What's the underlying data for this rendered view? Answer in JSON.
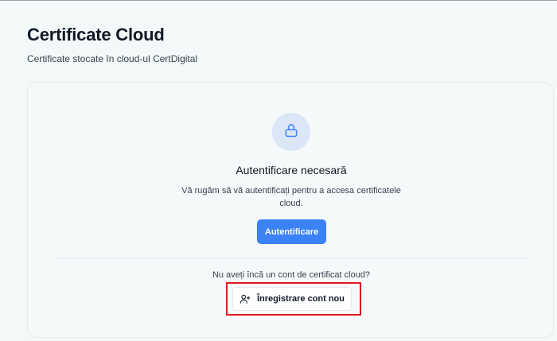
{
  "header": {
    "title": "Certificate Cloud",
    "subtitle": "Certificate stocate în cloud-ul CertDigital"
  },
  "auth_card": {
    "lock_icon": "lock-icon",
    "title": "Autentificare necesară",
    "description": "Vă rugăm să vă autentificați pentru a accesa certificatele cloud.",
    "login_button_label": "Autentificare",
    "register_prompt": "Nu aveți încă un cont de certificat cloud?",
    "register_button_label": "Înregistrare cont nou",
    "register_icon": "user-plus-icon"
  },
  "colors": {
    "accent": "#3b82f6",
    "highlight": "#e01b1b",
    "background": "#f3f8f8"
  }
}
